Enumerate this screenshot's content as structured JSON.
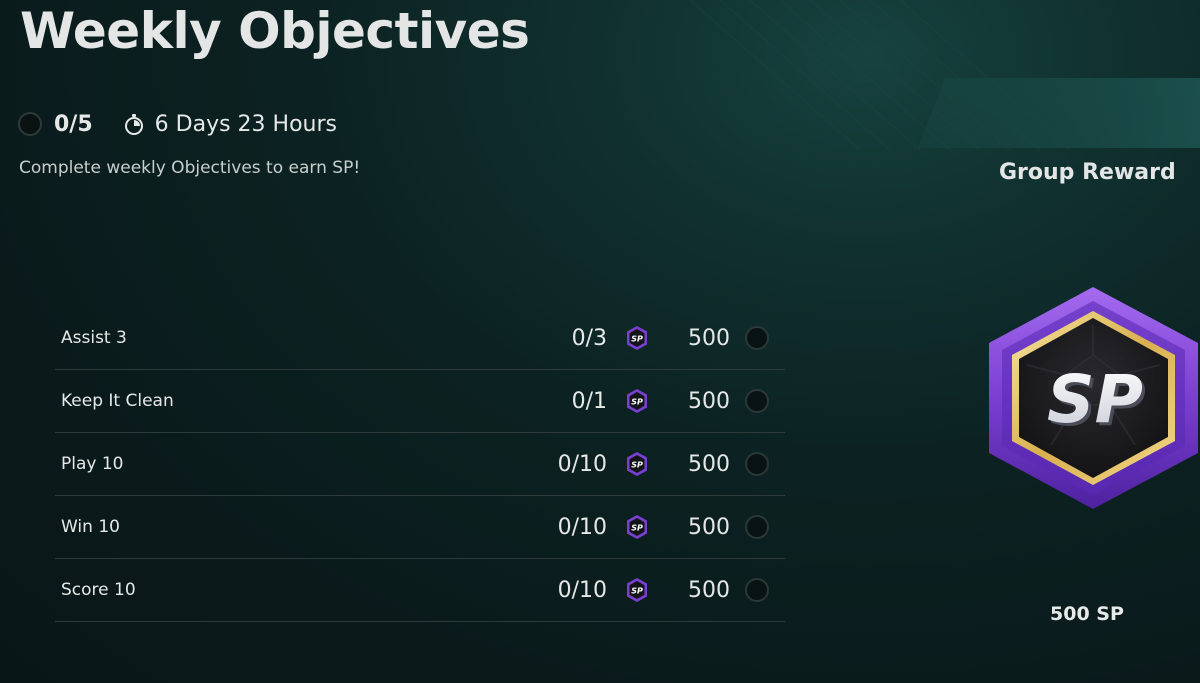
{
  "header": {
    "title": "Weekly Objectives",
    "progress": "0/5",
    "timer": "6 Days 23 Hours",
    "subtitle": "Complete weekly Objectives to earn SP!"
  },
  "objectives": [
    {
      "label": "Assist 3",
      "progress": "0/3",
      "reward": "500",
      "completed": false
    },
    {
      "label": "Keep It Clean",
      "progress": "0/1",
      "reward": "500",
      "completed": false
    },
    {
      "label": "Play 10",
      "progress": "0/10",
      "reward": "500",
      "completed": false
    },
    {
      "label": "Win 10",
      "progress": "0/10",
      "reward": "500",
      "completed": false
    },
    {
      "label": "Score 10",
      "progress": "0/10",
      "reward": "500",
      "completed": false
    }
  ],
  "group_reward": {
    "title": "Group Reward",
    "badge_text": "SP",
    "amount": "500 SP"
  },
  "icons": {
    "progress": "empty-circle-icon",
    "timer": "stopwatch-icon",
    "reward_currency": "sp-coin-icon",
    "check": "empty-check-circle-icon",
    "badge": "sp-hexagon-badge-icon"
  },
  "colors": {
    "background": "#0c2222",
    "accent_teal": "#16423f",
    "badge_purple": "#7a3fd0",
    "badge_gold": "#e8c86a",
    "text": "#e6e8e8"
  }
}
